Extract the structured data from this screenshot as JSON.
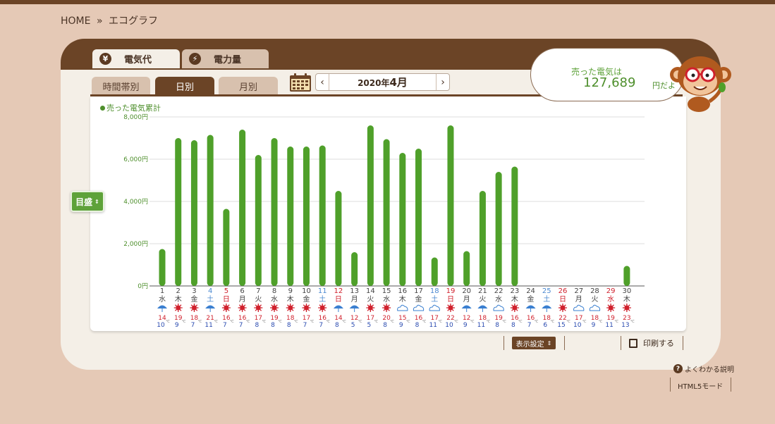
{
  "breadcrumb": {
    "home": "HOME",
    "sep": "»",
    "current": "エコグラフ"
  },
  "main_tabs": [
    {
      "icon": "¥",
      "label": "電気代",
      "active": true
    },
    {
      "icon": "⚡",
      "label": "電力量",
      "active": false
    }
  ],
  "sub_tabs": [
    {
      "label": "時間帯別",
      "active": false
    },
    {
      "label": "日別",
      "active": true
    },
    {
      "label": "月別",
      "active": false
    }
  ],
  "month_nav": {
    "prev": "‹",
    "next": "›",
    "year_prefix": "2020年",
    "month": "4月"
  },
  "legend": {
    "label": "売った電気累計"
  },
  "goal_button": {
    "label": "目盛"
  },
  "summary": {
    "label": "売った電気は",
    "value": "127,689",
    "suffix": "円だよ"
  },
  "toolbar": {
    "display_settings": "表示設定",
    "print": "印刷する"
  },
  "footer": {
    "help": "よくわかる説明",
    "html5": "HTML5モード"
  },
  "colors": {
    "bar": "#4fa02a",
    "sat": "#4b88d0",
    "sun": "#d0212d",
    "weekday": "#444444",
    "high": "#d0212d",
    "low": "#2a4bb0"
  },
  "chart_data": {
    "type": "bar",
    "yunit": "円",
    "ylim": [
      0,
      8000
    ],
    "yticks": [
      "0円",
      "2,000円",
      "4,000円",
      "6,000円",
      "8,000円"
    ],
    "days": [
      "1",
      "2",
      "3",
      "4",
      "5",
      "6",
      "7",
      "8",
      "9",
      "10",
      "11",
      "12",
      "13",
      "14",
      "15",
      "16",
      "17",
      "18",
      "19",
      "20",
      "21",
      "22",
      "23",
      "24",
      "25",
      "26",
      "27",
      "28",
      "29",
      "30"
    ],
    "weekdays": [
      "水",
      "木",
      "金",
      "土",
      "日",
      "月",
      "火",
      "水",
      "木",
      "金",
      "土",
      "日",
      "月",
      "火",
      "水",
      "木",
      "金",
      "土",
      "日",
      "月",
      "火",
      "水",
      "木",
      "金",
      "土",
      "日",
      "月",
      "火",
      "水",
      "木"
    ],
    "day_types": [
      "w",
      "w",
      "w",
      "sat",
      "sun",
      "w",
      "w",
      "w",
      "w",
      "w",
      "sat",
      "sun",
      "w",
      "w",
      "w",
      "w",
      "w",
      "sat",
      "sun",
      "w",
      "w",
      "w",
      "w",
      "w",
      "sat",
      "sun",
      "w",
      "w",
      "sun",
      "w"
    ],
    "values": [
      1750,
      7000,
      6900,
      7150,
      3650,
      7400,
      6200,
      7000,
      6600,
      6600,
      6650,
      4500,
      1600,
      7600,
      6950,
      6300,
      6500,
      1350,
      7600,
      1650,
      4500,
      5400,
      5650,
      null,
      null,
      null,
      null,
      null,
      null,
      950
    ],
    "weather": [
      "rain",
      "sun",
      "sun",
      "rain",
      "sun",
      "sun",
      "sun",
      "sun",
      "sun",
      "sun",
      "sun",
      "rain",
      "rain",
      "sun",
      "sun",
      "cloud",
      "cloud",
      "cloud",
      "sun",
      "rain",
      "rain",
      "cloud",
      "sun",
      "rain",
      "rain",
      "sun",
      "cloud",
      "cloud",
      "sun",
      "sun"
    ],
    "high_temps": [
      "14",
      "19",
      "18",
      "21",
      "16",
      "16",
      "17",
      "19",
      "18",
      "17",
      "16",
      "14",
      "12",
      "17",
      "20",
      "15",
      "16",
      "17",
      "22",
      "12",
      "18",
      "19",
      "16",
      "16",
      "18",
      "22",
      "17",
      "18",
      "19",
      "23"
    ],
    "low_temps": [
      "10",
      "9",
      "7",
      "11",
      "7",
      "7",
      "8",
      "8",
      "8",
      "7",
      "7",
      "8",
      "5",
      "5",
      "8",
      "9",
      "8",
      "11",
      "10",
      "9",
      "11",
      "8",
      "8",
      "7",
      "6",
      "15",
      "10",
      "9",
      "11",
      "13"
    ],
    "temp_unit": "℃"
  }
}
